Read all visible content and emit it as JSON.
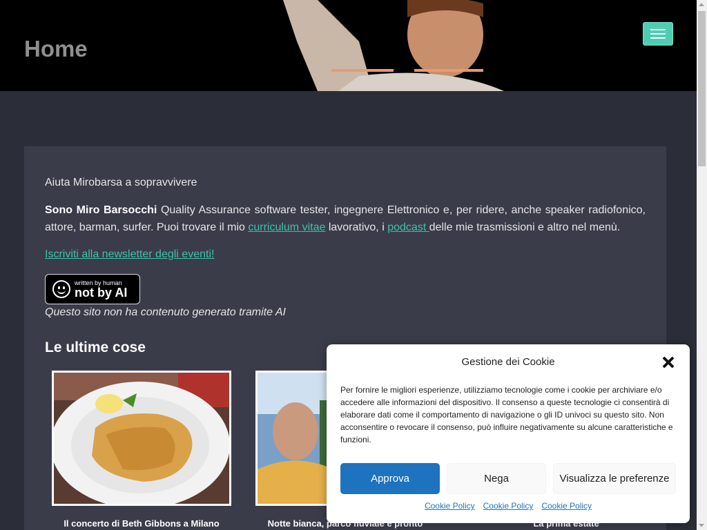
{
  "header": {
    "title": "Home",
    "menu_toggle": "menu"
  },
  "intro": "Aiuta Mirobarsa a sopravvivere",
  "bio": {
    "name": "Sono Miro Barsocchi",
    "text1": " Quality Assurance software tester, ingegnere Elettronico e, per ridere, anche speaker radiofonico, attore, barman, surfer. Puoi trovare il mio ",
    "link_cv": "curriculum vitae",
    "text2": " lavorativo, i ",
    "link_podcast": "podcast ",
    "text3": "delle mie trasmissioni e altro nel menù."
  },
  "newsletter_link": "Iscriviti alla newsletter degli eventi!",
  "badge": {
    "small": "written by human",
    "big": "not by AI"
  },
  "ai_note": "Questo sito non ha contenuto generato tramite AI",
  "section_title": "Le ultime cose",
  "posts": [
    {
      "caption": "Il concerto di Beth Gibbons a Milano"
    },
    {
      "caption": "Notte bianca, parco fluviale e pronto"
    },
    {
      "caption": "La prima estate"
    }
  ],
  "cookie": {
    "title": "Gestione dei Cookie",
    "body": "Per fornire le migliori esperienze, utilizziamo tecnologie come i cookie per archiviare e/o accedere alle informazioni del dispositivo. Il consenso a queste tecnologie ci consentirà di elaborare dati come il comportamento di navigazione o gli ID univoci su questo sito. Non acconsentire o revocare il consenso, può influire negativamente su alcune caratteristiche e funzioni.",
    "approve": "Approva",
    "deny": "Nega",
    "prefs": "Visualizza le preferenze",
    "links": [
      "Cookie Policy",
      "Cookie Policy",
      "Cookie Policy"
    ]
  },
  "colors": {
    "accent": "#3cc3a8",
    "header_bg": "#000000",
    "page_bg": "#2b2e38",
    "panel_bg": "#3a3c4a",
    "cookie_primary": "#1e73be"
  }
}
